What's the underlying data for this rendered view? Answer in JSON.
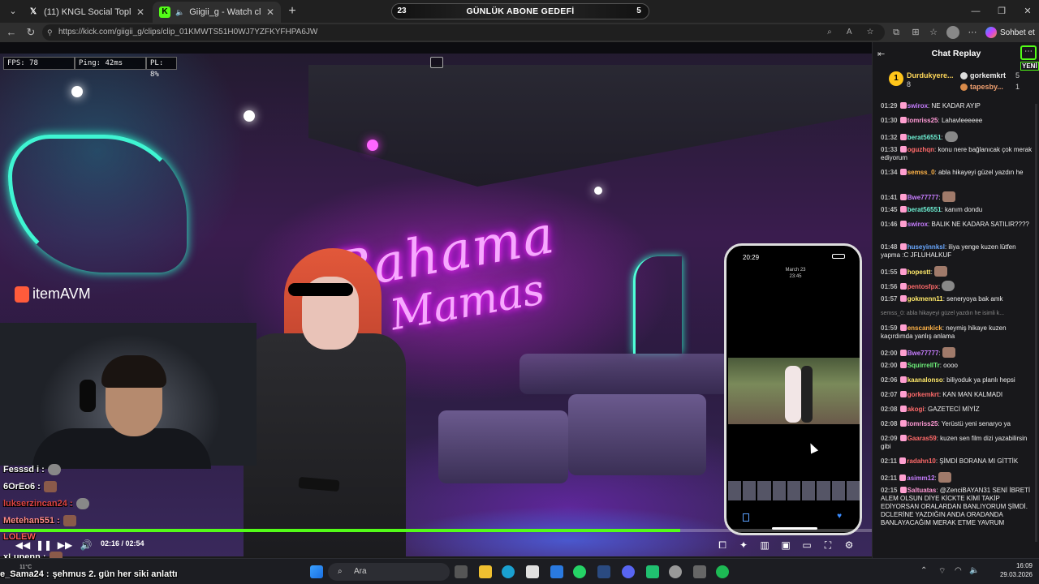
{
  "browser": {
    "tabs": [
      {
        "label": "(11) KNGL Social Topluluk / X",
        "favicon": "x-logo-icon"
      },
      {
        "label": "Giigii_g - Watch clips on Kick",
        "favicon": "kick-logo-icon",
        "active": true
      }
    ],
    "url": "https://kick.com/giigii_g/clips/clip_01KMWTS51H0WJ7YZFKYFHPA6JW",
    "copilot_label": "Sohbet et",
    "sub_goal": {
      "left": "23",
      "label": "GÜNLÜK ABONE GEDEFİ",
      "right": "5"
    }
  },
  "video": {
    "stats": {
      "fps": "FPS: 78",
      "ping": "Ping: 42ms",
      "pl": "PL: 8%"
    },
    "sponsor": "itemAVM",
    "sign_line1": "Bahama",
    "sign_line2": "Mamas",
    "phone": {
      "time": "20:29",
      "date_line1": "March 23",
      "date_line2": "23:45"
    },
    "overlay_chat": [
      {
        "user": "Fesssd i :"
      },
      {
        "user": "6OrEo6 :"
      },
      {
        "user": "lukserzincan24 :"
      },
      {
        "user": "Metehan551 :"
      },
      {
        "user": "LOLEW"
      },
      {
        "user": "xLupenn :"
      },
      {
        "user": "e_Sama24 :",
        "text": "şehmus 2. gün her siki anlattı"
      }
    ],
    "time_readout": "02:16 / 02:54",
    "progress": 0.78
  },
  "chat": {
    "title": "Chat Replay",
    "new_label": "YENİ",
    "gifters": [
      {
        "rank": "1",
        "name": "Durdukyere...",
        "count": "8"
      },
      {
        "name": "gorkemkrt",
        "count": "5"
      },
      {
        "name": "tapesby...",
        "count": "1"
      }
    ],
    "messages": [
      {
        "t": "01:29",
        "u": "swirox",
        "c": "#c77dff",
        "m": ": NE KADAR AYIP"
      },
      {
        "t": "01:30",
        "u": "tomriss25",
        "c": "#ff9ad5",
        "m": ": Lahavleeeeee"
      },
      {
        "t": "01:32",
        "u": "berat56551",
        "c": "#6ef0d4",
        "m": ":",
        "emote": "grey"
      },
      {
        "t": "01:33",
        "u": "oguzhqn",
        "c": "#ff6a6a",
        "m": ": konu nere bağlanıcak çok merak ediyorum"
      },
      {
        "t": "01:34",
        "u": "semss_0",
        "c": "#ffb347",
        "m": ": abla hikayeyi güzel yazdın he"
      },
      {
        "t": "01:41",
        "u": "Bwe77777",
        "c": "#c77dff",
        "m": ":",
        "emote": "face"
      },
      {
        "t": "01:45",
        "u": "berat56551",
        "c": "#6ef0d4",
        "m": ": kanım dondu"
      },
      {
        "t": "01:46",
        "u": "swirox",
        "c": "#c77dff",
        "m": ": BALIK NE KADARA SATILIR????"
      },
      {
        "t": "01:48",
        "u": "huseyinnksl",
        "c": "#6aa8ff",
        "m": ": iliya yenge kuzen lütfen yapma :C JFLUHALKUF"
      },
      {
        "t": "01:55",
        "u": "hopestt",
        "c": "#ffe96a",
        "m": ":",
        "emote": "face"
      },
      {
        "t": "01:56",
        "u": "pentosfpx",
        "c": "#ff6a6a",
        "m": ":",
        "emote": "grey"
      },
      {
        "t": "01:57",
        "u": "gokmenn11",
        "c": "#ffe96a",
        "m": ": seneryoya bak amk"
      },
      {
        "reply": "semss_0: abla hikayeyi güzel yazdın he isimli k..."
      },
      {
        "t": "01:59",
        "u": "enscankick",
        "c": "#ffb347",
        "m": ": neymiş hikaye kuzen kaçırdımda yanlış anlama"
      },
      {
        "t": "02:00",
        "u": "Bwe77777",
        "c": "#c77dff",
        "m": ":",
        "emote": "face"
      },
      {
        "t": "02:00",
        "u": "SquirrelITr",
        "c": "#6ef07a",
        "m": ": oooo"
      },
      {
        "t": "02:06",
        "u": "kaanalonso",
        "c": "#ffe96a",
        "m": ": biliyoduk ya planlı hepsi"
      },
      {
        "t": "02:07",
        "u": "gorkemkrt",
        "c": "#ff6a6a",
        "m": ": KAN MAN KALMADI"
      },
      {
        "t": "02:08",
        "u": "akogi",
        "c": "#ff6a6a",
        "m": ": GAZETECİ MİYİZ"
      },
      {
        "t": "02:08",
        "u": "tomriss25",
        "c": "#ff9ad5",
        "m": ": Yerüstü yeni senaryo ya"
      },
      {
        "t": "02:09",
        "u": "Gaaras59",
        "c": "#ff6a6a",
        "m": ": kuzen sen film dizi yazabilirsin gibi"
      },
      {
        "t": "02:11",
        "u": "radahn10",
        "c": "#ff6a6a",
        "m": ": ŞİMDİ BORANA MI GİTTİK"
      },
      {
        "t": "02:11",
        "u": "asimm12",
        "c": "#c77dff",
        "m": ":",
        "emote": "face"
      },
      {
        "t": "02:15",
        "u": "Saltuatas",
        "c": "#ff9ad5",
        "m": ": @ZenciBAYAN31 SENİ İBRETİ ALEM OLSUN DİYE KİCKTE KİMİ TAKİP EDİYORSAN ORALARDAN BANLIYORUM ŞİMDİ. DCLERİNE YAZDIĞIN ANDA ORADANDA BANLAYACAĞIM MERAK ETME YAVRUM"
      }
    ]
  },
  "taskbar": {
    "search": "Ara",
    "temp": "11°C",
    "time": "16:09",
    "date": "29.03.2026"
  }
}
